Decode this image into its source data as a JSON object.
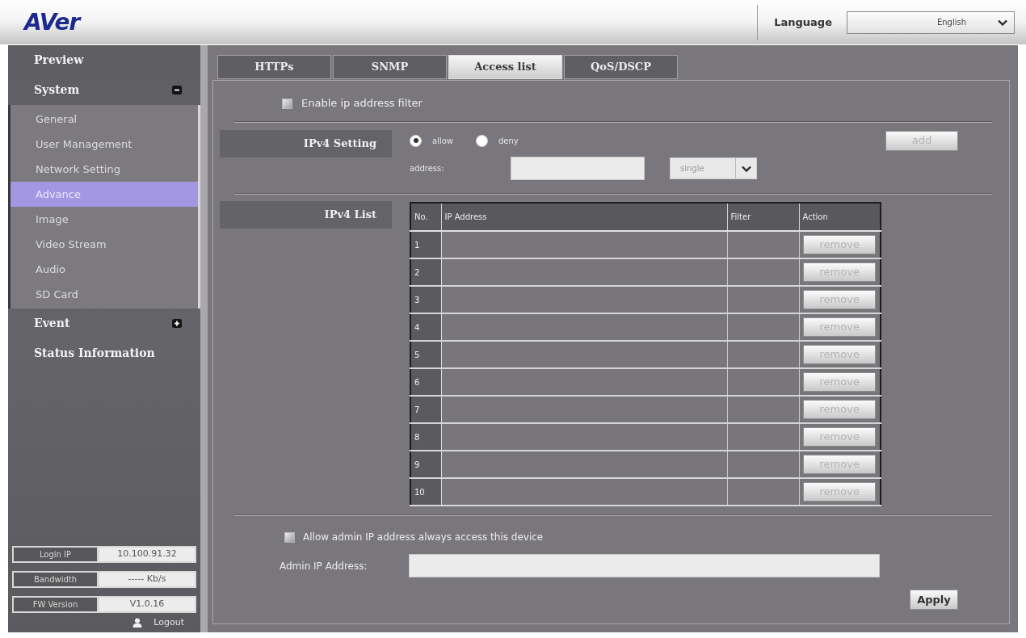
{
  "header": {
    "logo": "AVer",
    "language_label": "Language",
    "language_value": "English"
  },
  "sidebar": {
    "items": [
      {
        "label": "Preview",
        "kind": "link"
      },
      {
        "label": "System",
        "kind": "group",
        "expanded": true,
        "children": [
          {
            "label": "General",
            "selected": false
          },
          {
            "label": "User Management",
            "selected": false
          },
          {
            "label": "Network Setting",
            "selected": false
          },
          {
            "label": "Advance",
            "selected": true
          },
          {
            "label": "Image",
            "selected": false
          },
          {
            "label": "Video Stream",
            "selected": false
          },
          {
            "label": "Audio",
            "selected": false
          },
          {
            "label": "SD Card",
            "selected": false
          }
        ]
      },
      {
        "label": "Event",
        "kind": "group",
        "expanded": false
      },
      {
        "label": "Status Information",
        "kind": "link"
      }
    ],
    "info": [
      {
        "label": "Login IP",
        "value": "10.100.91.32"
      },
      {
        "label": "Bandwidth",
        "value": "----- Kb/s"
      },
      {
        "label": "FW Version",
        "value": "V1.0.16"
      }
    ],
    "logout": "Logout"
  },
  "tabs": [
    {
      "label": "HTTPs",
      "selected": false
    },
    {
      "label": "SNMP",
      "selected": false
    },
    {
      "label": "Access list",
      "selected": true
    },
    {
      "label": "QoS/DSCP",
      "selected": false
    }
  ],
  "filter_checkbox": {
    "label": "Enable ip address filter",
    "checked": false
  },
  "ipv4_setting": {
    "title": "IPv4 Setting",
    "options": [
      {
        "label": "allow",
        "selected": true
      },
      {
        "label": "deny",
        "selected": false
      }
    ],
    "add_button": {
      "label": "add",
      "disabled": true
    },
    "address_label": "address:",
    "address_type": "single"
  },
  "ipv4_list": {
    "title": "IPv4 List",
    "columns": [
      "No.",
      "IP Address",
      "Filter",
      "Action"
    ],
    "rows": [
      {
        "no": "1",
        "button": {
          "label": "remove",
          "disabled": true
        }
      },
      {
        "no": "2",
        "button": {
          "label": "remove",
          "disabled": true
        }
      },
      {
        "no": "3",
        "button": {
          "label": "remove",
          "disabled": true
        }
      },
      {
        "no": "4",
        "button": {
          "label": "remove",
          "disabled": true
        }
      },
      {
        "no": "5",
        "button": {
          "label": "remove",
          "disabled": true
        }
      },
      {
        "no": "6",
        "button": {
          "label": "remove",
          "disabled": true
        }
      },
      {
        "no": "7",
        "button": {
          "label": "remove",
          "disabled": true
        }
      },
      {
        "no": "8",
        "button": {
          "label": "remove",
          "disabled": true
        }
      },
      {
        "no": "9",
        "button": {
          "label": "remove",
          "disabled": true
        }
      },
      {
        "no": "10",
        "button": {
          "label": "remove",
          "disabled": true
        }
      }
    ]
  },
  "admin": {
    "checkbox": {
      "label": "Allow admin IP address always access this device",
      "checked": false
    },
    "address_label": "Admin IP Address:"
  },
  "apply_button": {
    "label": "Apply",
    "disabled": false
  }
}
